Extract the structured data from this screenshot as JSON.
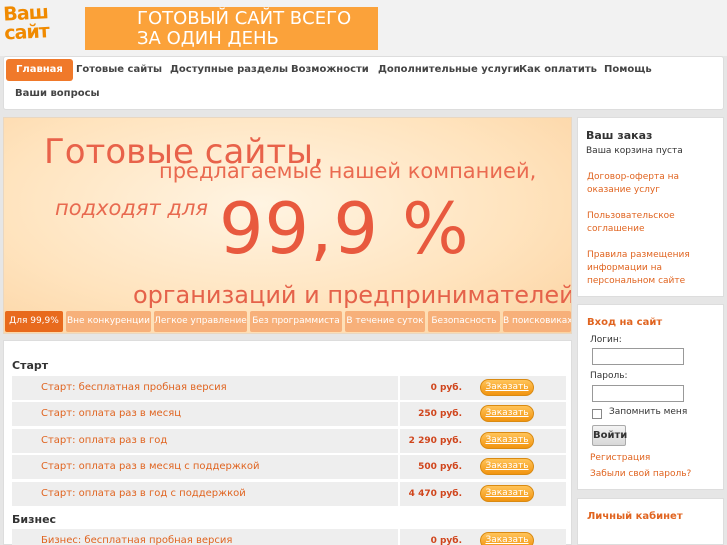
{
  "header": {
    "logo_line1": "Ваш",
    "logo_line2": "сайт",
    "promo_line1": "ГОТОВЫЙ САЙТ ВСЕГО",
    "promo_line2": "ЗА ОДИН ДЕНЬ"
  },
  "nav": {
    "items": [
      {
        "label": "Главная"
      },
      {
        "label": "Готовые сайты"
      },
      {
        "label": "Доступные разделы"
      },
      {
        "label": "Возможности"
      },
      {
        "label": "Дополнительные услуги"
      },
      {
        "label": "Как оплатить"
      },
      {
        "label": "Помощь"
      },
      {
        "label": "Ваши вопросы"
      }
    ]
  },
  "banner": {
    "line1": "Готовые сайты,",
    "line2": "предлагаемые нашей компанией,",
    "line3": "подходят для",
    "big": "99,9 %",
    "line4": "организаций и предпринимателей",
    "tabs": [
      {
        "label": "Для 99,9%"
      },
      {
        "label": "Вне конкуренции"
      },
      {
        "label": "Легкое управление"
      },
      {
        "label": "Без программиста"
      },
      {
        "label": "В течение суток"
      },
      {
        "label": "Безопасность"
      },
      {
        "label": "В поисковиках"
      }
    ]
  },
  "catalog": {
    "sections": [
      {
        "title": "Старт",
        "rows": [
          {
            "name": "Старт: бесплатная пробная версия",
            "price": "0 руб.",
            "button": "Заказать"
          },
          {
            "name": "Старт: оплата раз в месяц",
            "price": "250 руб.",
            "button": "Заказать"
          },
          {
            "name": "Старт: оплата раз в год",
            "price": "2 290 руб.",
            "button": "Заказать"
          },
          {
            "name": "Старт: оплата раз в месяц с поддержкой",
            "price": "500 руб.",
            "button": "Заказать"
          },
          {
            "name": "Старт: оплата раз в год с поддержкой",
            "price": "4 470 руб.",
            "button": "Заказать"
          }
        ]
      },
      {
        "title": "Бизнес",
        "rows": [
          {
            "name": "Бизнес: бесплатная пробная версия",
            "price": "0 руб.",
            "button": "Заказать"
          }
        ]
      }
    ]
  },
  "sidebar": {
    "order_title": "Ваш заказ",
    "cart_status": "Ваша корзина пуста",
    "links": [
      {
        "label": "Договор-оферта на оказание услуг"
      },
      {
        "label": "Пользовательское соглашение"
      },
      {
        "label": "Правила размещения информации на персональном сайте"
      }
    ],
    "login": {
      "title": "Вход на сайт",
      "login_label": "Логин:",
      "password_label": "Пароль:",
      "remember_label": "Запомнить меня",
      "submit": "Войти",
      "register": "Регистрация",
      "forgot": "Забыли свой пароль?"
    },
    "cabinet": "Личный кабинет"
  },
  "colors": {
    "accent": "#f0792a",
    "promo": "#fba23a",
    "link": "#e06420"
  }
}
